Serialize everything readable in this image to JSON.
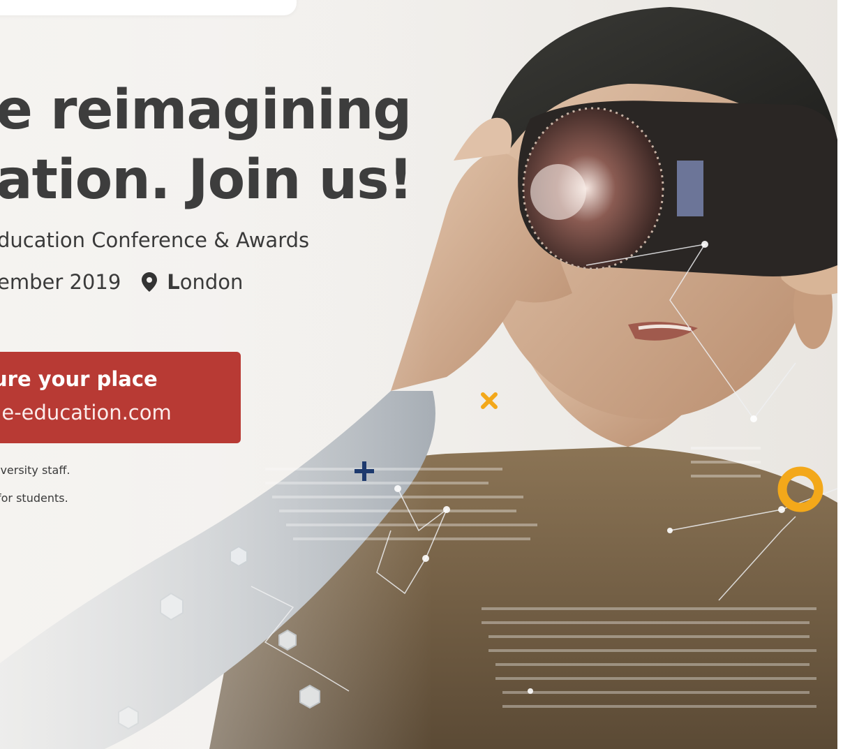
{
  "headline": {
    "line1": "e reimagining",
    "line2": "ation. Join us!"
  },
  "event": {
    "subtitle": "ducation Conference & Awards",
    "date": "ember 2019",
    "location_initial": "L",
    "location_rest": "ondon"
  },
  "cta": {
    "line1": "ure your place",
    "line2": "he-education.com"
  },
  "notes": {
    "line1": "iversity staff.",
    "line2": "for students."
  },
  "icons": {
    "location": "map-pin-icon",
    "cross": "x-icon",
    "plus": "plus-icon",
    "ring": "circle-icon"
  },
  "colors": {
    "cta_background": "#b83a34",
    "accent_yellow": "#f3a81a",
    "accent_navy": "#1e3a6e",
    "headline": "#3d3d3d"
  }
}
